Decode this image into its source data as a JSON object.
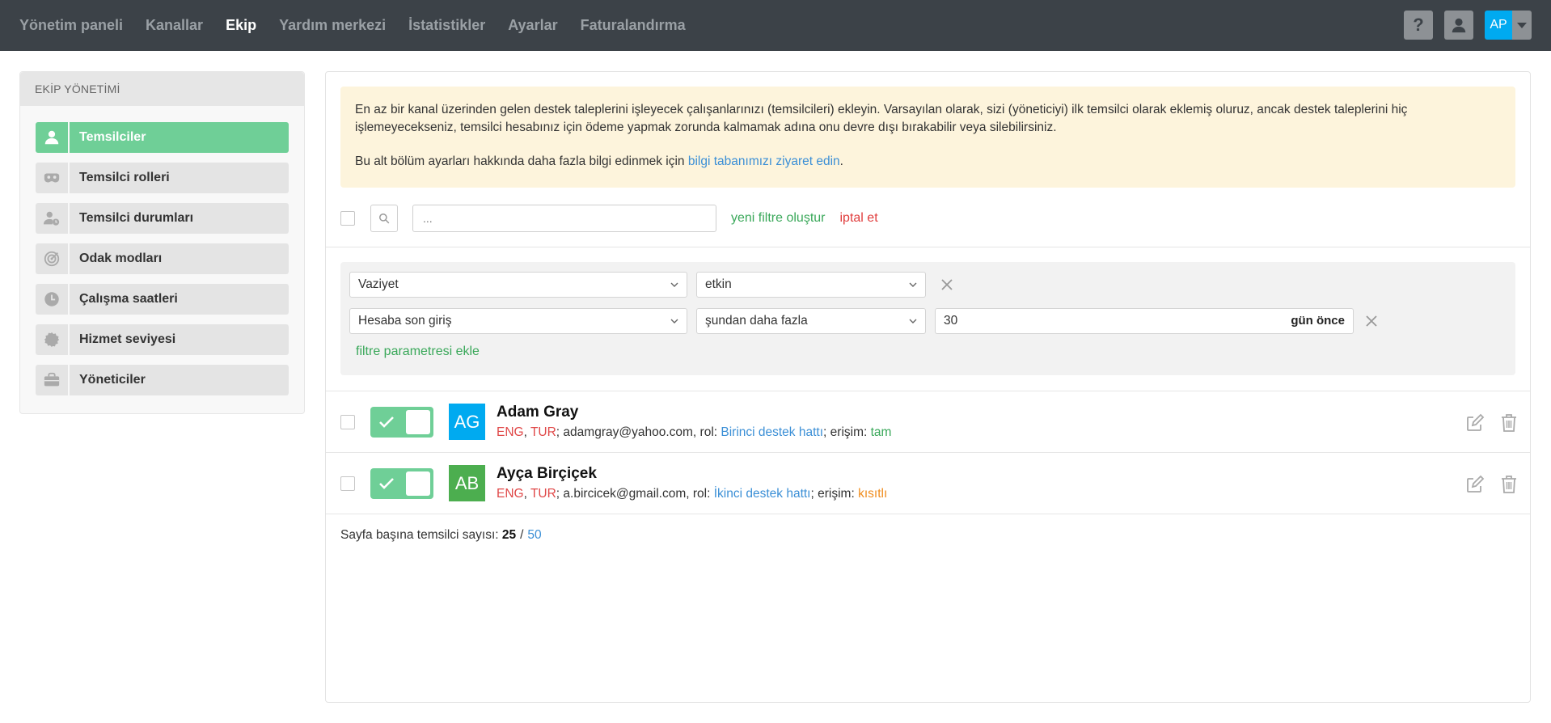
{
  "nav": {
    "items": [
      {
        "label": "Yönetim paneli",
        "active": false
      },
      {
        "label": "Kanallar",
        "active": false
      },
      {
        "label": "Ekip",
        "active": true
      },
      {
        "label": "Yardım merkezi",
        "active": false
      },
      {
        "label": "İstatistikler",
        "active": false
      },
      {
        "label": "Ayarlar",
        "active": false
      },
      {
        "label": "Faturalandırma",
        "active": false
      }
    ],
    "help_label": "?",
    "user_initials": "AP"
  },
  "sidebar": {
    "title": "EKİP YÖNETİMİ",
    "items": [
      {
        "label": "Temsilciler",
        "icon": "user-icon",
        "active": true
      },
      {
        "label": "Temsilci rolleri",
        "icon": "mask-icon",
        "active": false
      },
      {
        "label": "Temsilci durumları",
        "icon": "user-status-icon",
        "active": false
      },
      {
        "label": "Odak modları",
        "icon": "target-icon",
        "active": false
      },
      {
        "label": "Çalışma saatleri",
        "icon": "clock-icon",
        "active": false
      },
      {
        "label": "Hizmet seviyesi",
        "icon": "badge-icon",
        "active": false
      },
      {
        "label": "Yöneticiler",
        "icon": "briefcase-icon",
        "active": false
      }
    ]
  },
  "notice": {
    "text1": "En az bir kanal üzerinden gelen destek taleplerini işleyecek çalışanlarınızı (temsilcileri) ekleyin. Varsayılan olarak, sizi (yöneticiyi) ilk temsilci olarak eklemiş oluruz, ancak destek taleplerini hiç işlemeyecekseniz, temsilci hesabınız için ödeme yapmak zorunda kalmamak adına onu devre dışı bırakabilir veya silebilirsiniz.",
    "text2_prefix": "Bu alt bölüm ayarları hakkında daha fazla bilgi edinmek için ",
    "text2_link": "bilgi tabanımızı ziyaret edin",
    "text2_suffix": "."
  },
  "toolbar": {
    "search_placeholder": "...",
    "new_filter": "yeni filtre oluştur",
    "cancel": "iptal et"
  },
  "filters": {
    "row1": {
      "field": "Vaziyet",
      "value": "etkin"
    },
    "row2": {
      "field": "Hesaba son giriş",
      "operator": "şundan daha fazla",
      "value": "30",
      "suffix": "gün önce"
    },
    "add_label": "filtre parametresi ekle"
  },
  "agents": [
    {
      "initials": "AG",
      "avatar_color": "#00aaf0",
      "name": "Adam Gray",
      "lang1": "ENG",
      "lang2": "TUR",
      "email": "adamgray@yahoo.com",
      "role_label": "rol: ",
      "role": "Birinci destek hattı",
      "access_label": "erişim: ",
      "access": "tam",
      "access_color": "c-green"
    },
    {
      "initials": "AB",
      "avatar_color": "#4cae4f",
      "name": "Ayça Birçiçek",
      "lang1": "ENG",
      "lang2": "TUR",
      "email": "a.bircicek@gmail.com",
      "role_label": "rol: ",
      "role": "İkinci destek hattı",
      "access_label": "erişim: ",
      "access": "kısıtlı",
      "access_color": "c-orange"
    }
  ],
  "pagination": {
    "label": "Sayfa başına temsilci sayısı: ",
    "current": "25",
    "separator": "/",
    "alt": "50"
  }
}
